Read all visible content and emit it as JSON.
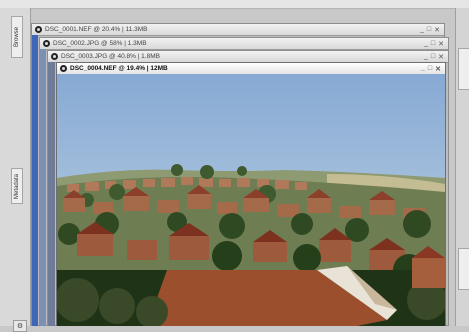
{
  "left_panel": {
    "tab_top": "Browse",
    "tab_middle": "Metadata",
    "bottom_button": "⚙"
  },
  "right_panel": {
    "tab_top": "",
    "tab_bottom": ""
  },
  "windows": [
    {
      "title": "DSC_0001.NEF @ 20.4% | 11.3MB"
    },
    {
      "title": "DSC_0002.JPG @ 58% | 1.3MB"
    },
    {
      "title": "DSC_0003.JPG @ 40.8% | 1.8MB"
    },
    {
      "title": "DSC_0004.NEF @ 19.4% | 12MB"
    }
  ],
  "window_buttons": {
    "minimize": "_",
    "maximize": "□",
    "close": "✕"
  },
  "photo": {
    "subject": "hillside-town-houses",
    "sky_color": "#8fb0d6",
    "roof_color": "#9a5534"
  }
}
